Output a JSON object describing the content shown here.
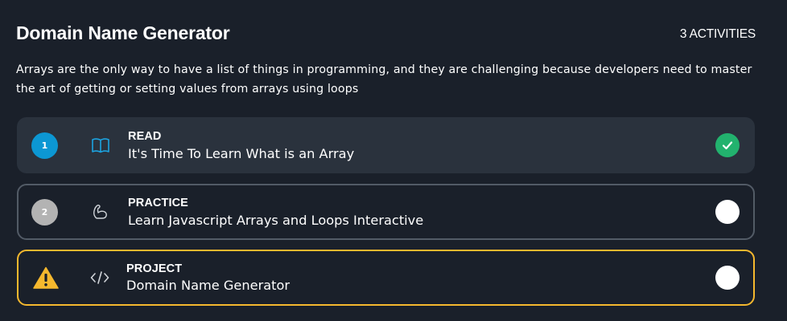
{
  "header": {
    "title": "Domain Name Generator",
    "activity_count": "3 ACTIVITIES"
  },
  "description": "Arrays are the only way to have a list of things in programming, and they are challenging because developers need to master the art of getting or setting values from arrays using loops",
  "activities": [
    {
      "number": "1",
      "type": "READ",
      "title": "It's Time To Learn What is an Array",
      "type_icon": "book-icon",
      "status": "completed",
      "status_icon": "checkmark-icon"
    },
    {
      "number": "2",
      "type": "PRACTICE",
      "title": "Learn Javascript Arrays and Loops Interactive",
      "type_icon": "flexed-arm-icon",
      "status": "not-completed",
      "status_icon": "empty-circle-icon"
    },
    {
      "number": "",
      "type": "PROJECT",
      "title": "Domain Name Generator",
      "type_icon": "code-brackets-icon",
      "marker_icon": "warning-icon",
      "status": "not-completed",
      "status_icon": "empty-circle-icon"
    }
  ],
  "colors": {
    "background": "#1a202a",
    "accent_blue": "#0c97d3",
    "success_green": "#22b26e",
    "warning_yellow": "#f5b82e",
    "card_fill": "#2a323d"
  }
}
